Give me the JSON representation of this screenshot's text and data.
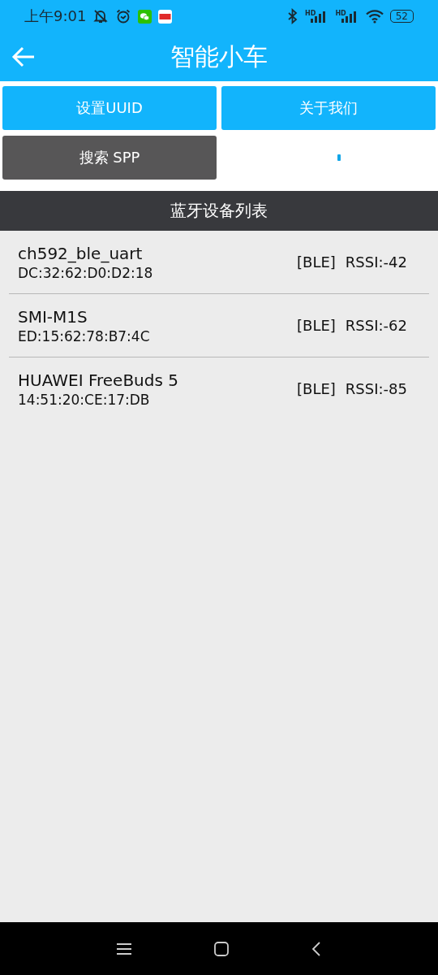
{
  "status_bar": {
    "time": "上午9:01",
    "signal_labels": [
      "HD",
      "HD"
    ],
    "battery": "52"
  },
  "app_bar": {
    "title": "智能小车"
  },
  "buttons": [
    {
      "label": "设置UUID",
      "kind": "primary"
    },
    {
      "label": "关于我们",
      "kind": "primary"
    },
    {
      "label": "搜索 SPP",
      "kind": "dark"
    }
  ],
  "scanning": true,
  "list_header": "蓝牙设备列表",
  "devices": [
    {
      "name": "ch592_ble_uart",
      "address": "DC:32:62:D0:D2:18",
      "type": "[BLE]",
      "rssi": "RSSI:-42"
    },
    {
      "name": "SMI-M1S",
      "address": "ED:15:62:78:B7:4C",
      "type": "[BLE]",
      "rssi": "RSSI:-62"
    },
    {
      "name": "HUAWEI FreeBuds 5",
      "address": "14:51:20:CE:17:DB",
      "type": "[BLE]",
      "rssi": "RSSI:-85"
    }
  ]
}
